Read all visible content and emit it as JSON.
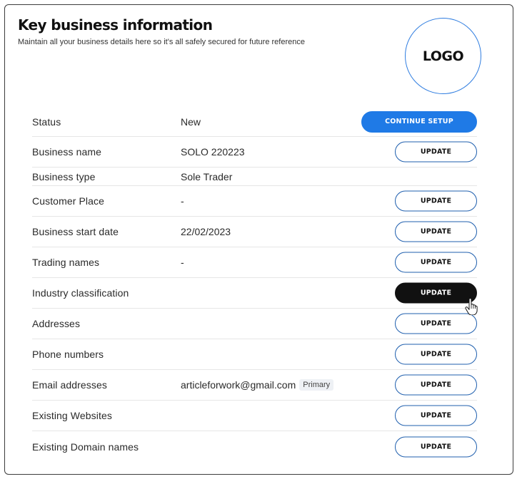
{
  "header": {
    "title": "Key business information",
    "subtitle": "Maintain all your business details here so it's all safely secured for future reference",
    "logo_text": "LOGO"
  },
  "rows": [
    {
      "label": "Status",
      "value": "New",
      "button": "CONTINUE SETUP"
    },
    {
      "label": "Business name",
      "value": "SOLO 220223",
      "button": "UPDATE"
    },
    {
      "label": "Business type",
      "value": "Sole Trader"
    },
    {
      "label": "Customer Place",
      "value": "-",
      "button": "UPDATE"
    },
    {
      "label": "Business start date",
      "value": "22/02/2023",
      "button": "UPDATE"
    },
    {
      "label": "Trading names",
      "value": "-",
      "button": "UPDATE"
    },
    {
      "label": "Industry classification",
      "value": "",
      "button": "UPDATE"
    },
    {
      "label": "Addresses",
      "value": "",
      "button": "UPDATE"
    },
    {
      "label": "Phone numbers",
      "value": "",
      "button": "UPDATE"
    },
    {
      "label": "Email addresses",
      "value": "articleforwork@gmail.com",
      "badge": "Primary",
      "button": "UPDATE"
    },
    {
      "label": "Existing Websites",
      "value": "",
      "button": "UPDATE"
    },
    {
      "label": "Existing Domain names",
      "value": "",
      "button": "UPDATE"
    }
  ],
  "colors": {
    "accent": "#1f7ae6",
    "button_border": "#1f5fae",
    "hover_button": "#111111",
    "logo_border": "#2f7de0"
  },
  "icons": {
    "cursor": "hand-pointer-cursor-icon"
  }
}
